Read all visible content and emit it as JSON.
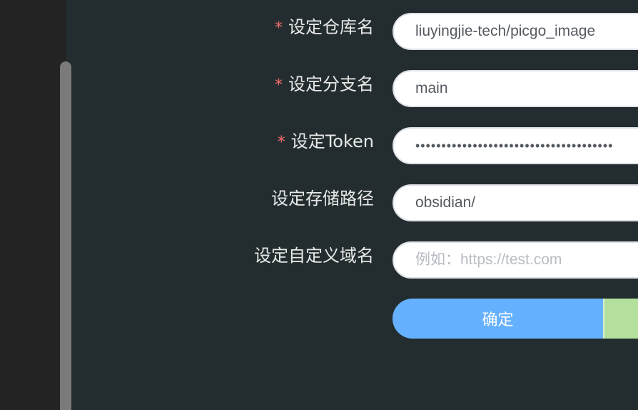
{
  "form": {
    "repo": {
      "label": "设定仓库名",
      "required": "*",
      "value": "liuyingjie-tech/picgo_image"
    },
    "branch": {
      "label": "设定分支名",
      "required": "*",
      "value": "main"
    },
    "token": {
      "label": "设定Token",
      "required": "*",
      "value": "••••••••••••••••••••••••••••••••••••••"
    },
    "path": {
      "label": "设定存储路径",
      "value": "obsidian/"
    },
    "custom_domain": {
      "label": "设定自定义域名",
      "value": "",
      "placeholder": "例如：https://test.com"
    }
  },
  "actions": {
    "confirm_label": "确定"
  },
  "colors": {
    "background": "#232d2f",
    "confirm": "#66b1ff",
    "secondary": "#b3e19d",
    "required": "#f56c6c"
  }
}
